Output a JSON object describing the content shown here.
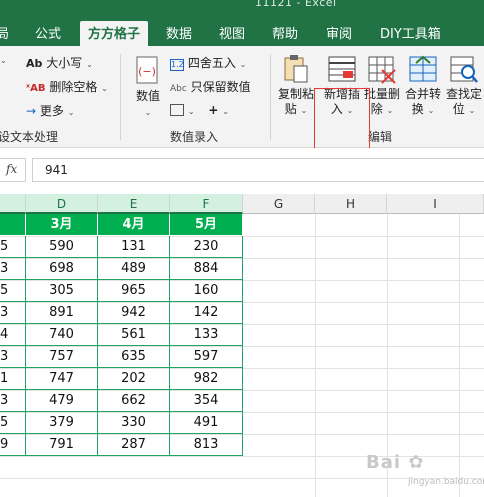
{
  "titlebar": {
    "title": "11121 - Excel"
  },
  "tabs": [
    {
      "label": "局"
    },
    {
      "label": "公式"
    },
    {
      "label": "方方格子",
      "active": true
    },
    {
      "label": "数据"
    },
    {
      "label": "视图"
    },
    {
      "label": "帮助"
    },
    {
      "label": "审阅"
    },
    {
      "label": "DIY工具箱"
    }
  ],
  "ribbon": {
    "text_group": {
      "case_label": "大小写",
      "remove_space_label": "删除空格",
      "more_label": "更多",
      "group_label": "设文本处理"
    },
    "number_group": {
      "value_label": "数值",
      "round_label": "四舍五入",
      "keep_value_label": "只保留数值",
      "group_label": "数值录入"
    },
    "edit_group": {
      "copy_paste_label_1": "复制粘",
      "copy_paste_label_2": "贴",
      "new_insert_label_1": "新增插",
      "new_insert_label_2": "入",
      "batch_delete_label_1": "批量删",
      "batch_delete_label_2": "除",
      "merge_label_1": "合并转",
      "merge_label_2": "换",
      "find_label_1": "查找定",
      "find_label_2": "位",
      "group_label": "编辑"
    }
  },
  "formula_bar": {
    "fx": "fx",
    "value": "941"
  },
  "columns": [
    "D",
    "E",
    "F",
    "G",
    "H",
    "I"
  ],
  "table": {
    "headers": [
      "3月",
      "4月",
      "5月"
    ],
    "row_stubs": [
      "5",
      "3",
      "5",
      "3",
      "4",
      "3",
      "1",
      "3",
      "5",
      "9"
    ],
    "rows": [
      [
        "590",
        "131",
        "230"
      ],
      [
        "698",
        "489",
        "884"
      ],
      [
        "305",
        "965",
        "160"
      ],
      [
        "891",
        "942",
        "142"
      ],
      [
        "740",
        "561",
        "133"
      ],
      [
        "757",
        "635",
        "597"
      ],
      [
        "747",
        "202",
        "982"
      ],
      [
        "479",
        "662",
        "354"
      ],
      [
        "379",
        "330",
        "491"
      ],
      [
        "791",
        "287",
        "813"
      ]
    ]
  },
  "watermark": {
    "brand": "Bai",
    "sub": "jingyan.baidu.com"
  }
}
